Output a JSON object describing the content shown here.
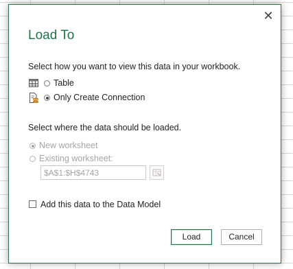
{
  "dialog": {
    "title": "Load To",
    "close_glyph": "✕",
    "view_prompt": "Select how you want to view this data in your workbook.",
    "view_options": [
      {
        "label": "Table",
        "icon": "table-icon",
        "selected": false
      },
      {
        "label": "Only Create Connection",
        "icon": "connection-icon",
        "selected": true
      }
    ],
    "load_prompt": "Select where the data should be loaded.",
    "load_options": [
      {
        "label": "New worksheet",
        "selected": true,
        "enabled": false
      },
      {
        "label": "Existing worksheet:",
        "selected": false,
        "enabled": false
      }
    ],
    "range_value": "$A$1:$H$4743",
    "data_model_label": "Add this data to the Data Model",
    "data_model_checked": false,
    "buttons": {
      "load": "Load",
      "cancel": "Cancel"
    }
  },
  "colors": {
    "accent": "#217346",
    "disabled_text": "#a6a6a6"
  }
}
